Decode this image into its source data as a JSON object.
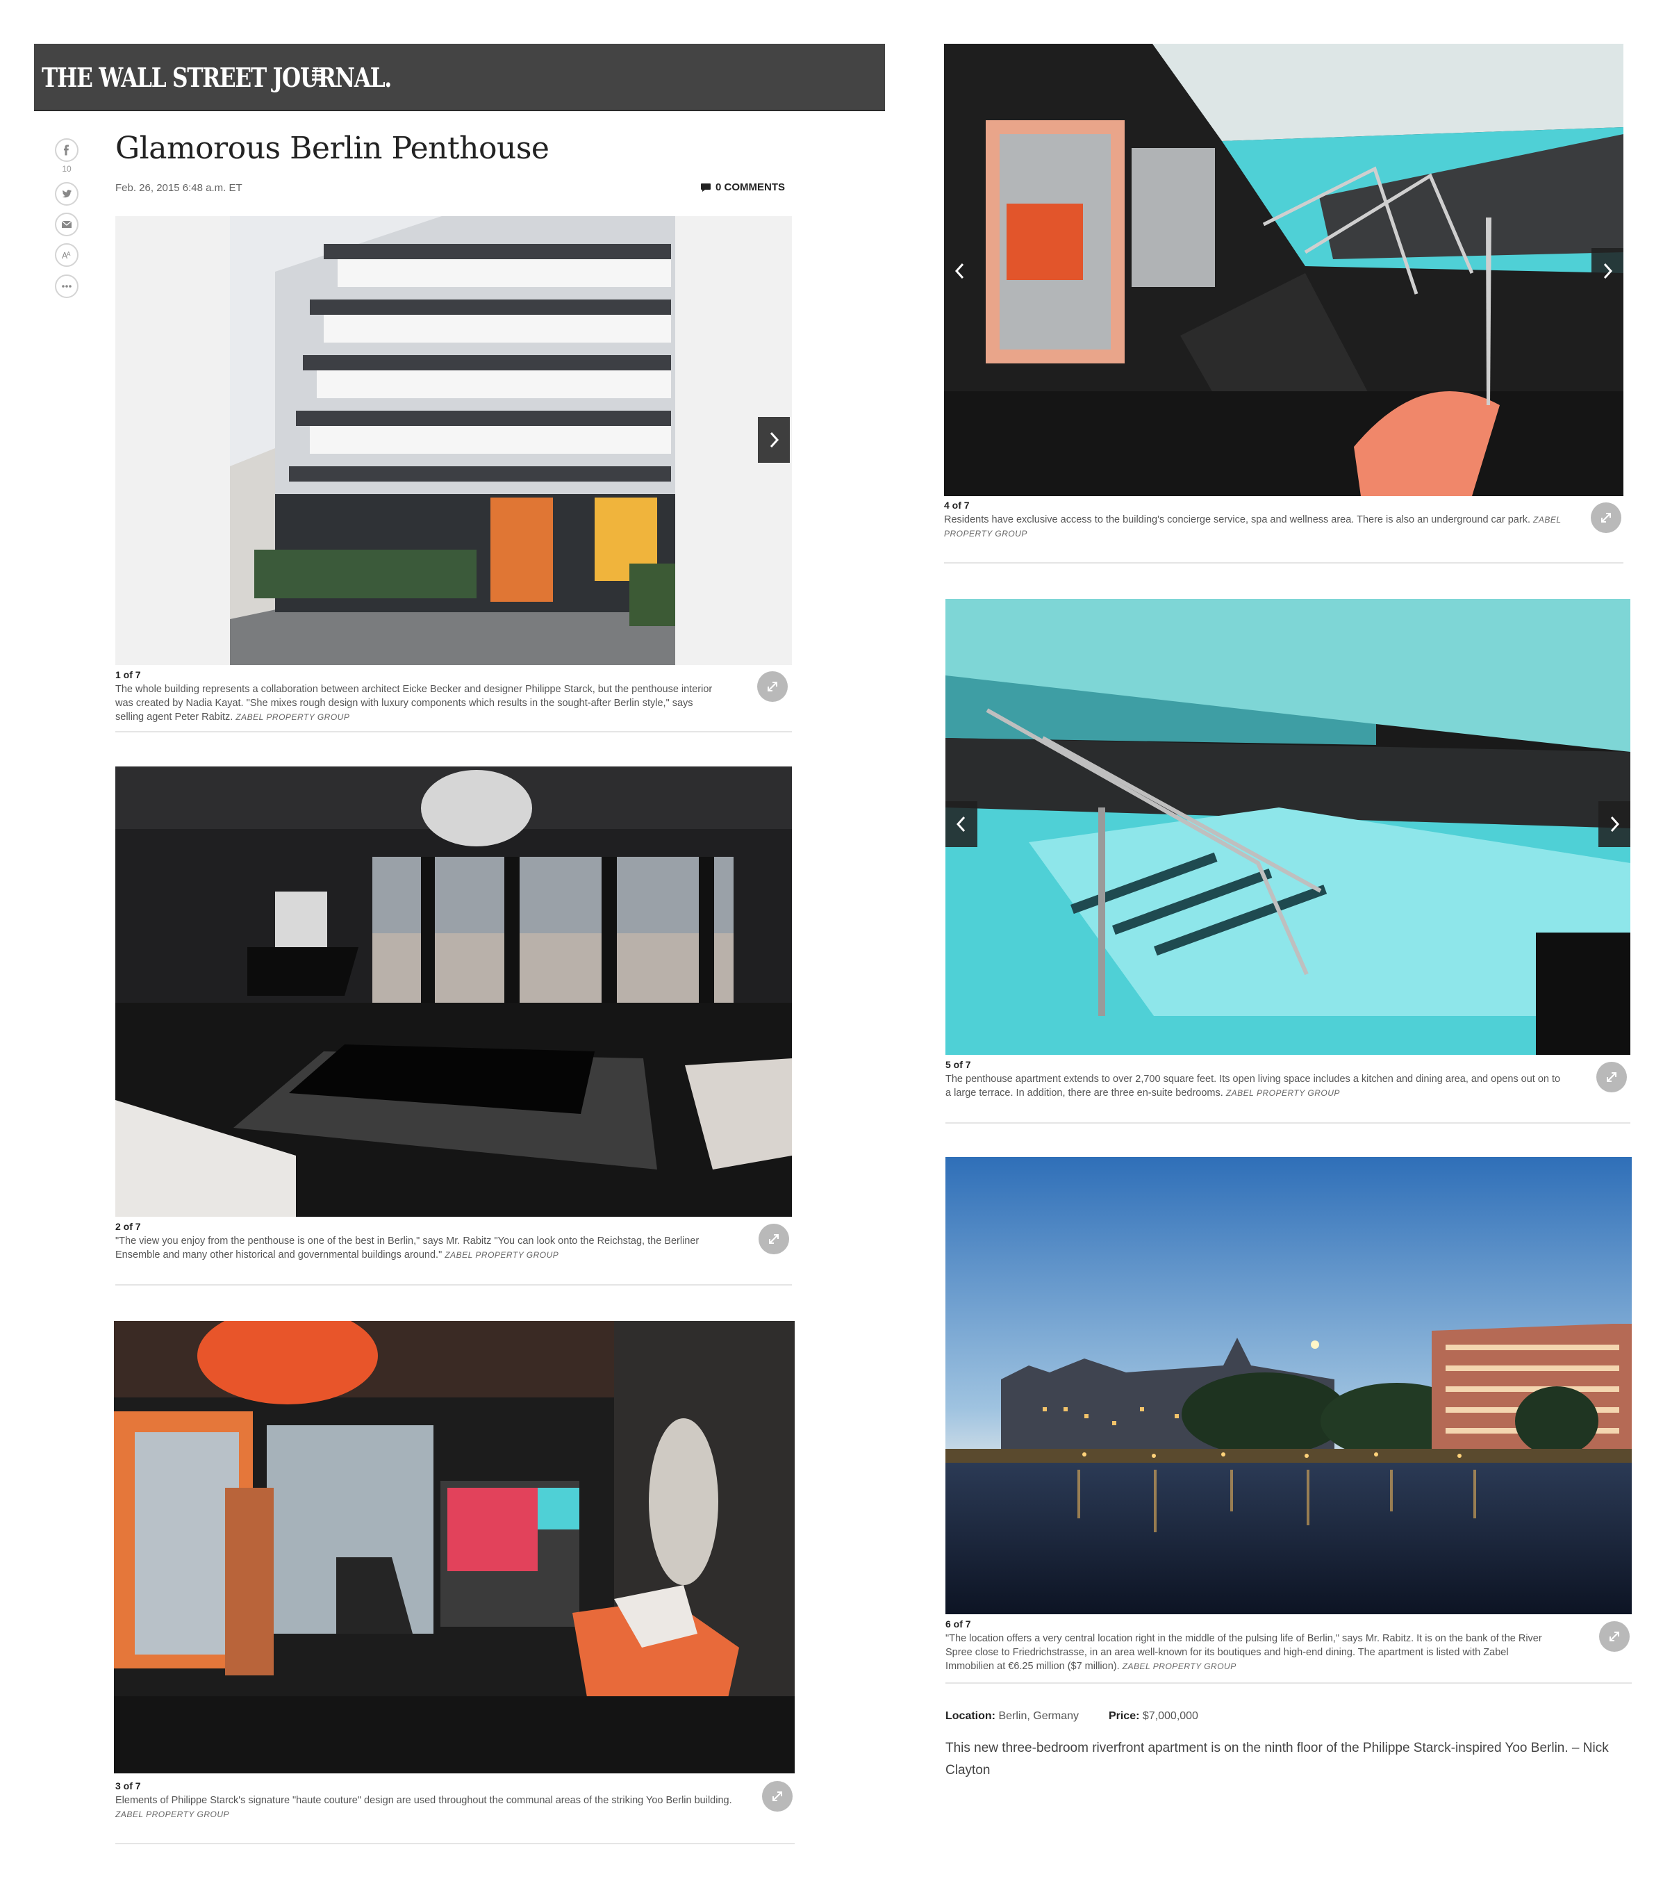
{
  "masthead": {
    "brand": "THE WALL STREET JOURNAL."
  },
  "share": {
    "facebook_count": "10"
  },
  "article": {
    "title": "Glamorous Berlin Penthouse",
    "dateline": "Feb. 26, 2015 6:48 a.m. ET",
    "comments_label": "0 COMMENTS"
  },
  "slides": [
    {
      "counter": "1 of 7",
      "caption": "The whole building represents a collaboration between architect Eicke Becker and designer Philippe Starck, but the penthouse interior was created by Nadia Kayat. \"She mixes rough design with luxury components which results in the sought-after Berlin style,\" says selling agent Peter Rabitz.",
      "credit": "ZABEL PROPERTY GROUP"
    },
    {
      "counter": "2 of 7",
      "caption": "\"The view you enjoy from the penthouse is one of the best in Berlin,\" says Mr. Rabitz \"You can look onto the Reichstag, the Berliner Ensemble and many other historical and governmental buildings around.\"",
      "credit": "ZABEL PROPERTY GROUP"
    },
    {
      "counter": "3 of 7",
      "caption": "Elements of Philippe Starck's signature \"haute couture\" design are used throughout the communal areas of the striking Yoo Berlin building.",
      "credit": "ZABEL PROPERTY GROUP"
    },
    {
      "counter": "4 of 7",
      "caption": "Residents have exclusive access to the building's concierge service, spa and wellness area. There is also an underground car park.",
      "credit": "ZABEL PROPERTY GROUP"
    },
    {
      "counter": "5 of 7",
      "caption": "The penthouse apartment extends to over 2,700 square feet. Its open living space includes a kitchen and dining area, and opens out on to a large terrace. In addition, there are three en-suite bedrooms.",
      "credit": "ZABEL PROPERTY GROUP"
    },
    {
      "counter": "6 of 7",
      "caption": "\"The location offers a very central location right in the middle of the pulsing life of Berlin,\" says Mr. Rabitz. It is on the bank of the River Spree close to Friedrichstrasse, in an area well-known for its boutiques and high-end dining. The apartment is listed with Zabel Immobilien at €6.25 million ($7 million).",
      "credit": "ZABEL PROPERTY GROUP"
    }
  ],
  "listing": {
    "location_label": "Location:",
    "location_value": "Berlin, Germany",
    "price_label": "Price:",
    "price_value": "$7,000,000",
    "summary": "This new three-bedroom riverfront apartment is on the ninth floor of the Philippe Starck-inspired Yoo Berlin. – Nick Clayton"
  },
  "colors": {
    "masthead_bg": "#444444",
    "accent_pool": "#4fd0d6",
    "accent_orange": "#e8552a"
  },
  "icons": [
    "menu-icon",
    "facebook-icon",
    "twitter-icon",
    "email-icon",
    "font-size-icon",
    "more-icon",
    "comment-icon",
    "chevron-left-icon",
    "chevron-right-icon",
    "expand-icon"
  ]
}
